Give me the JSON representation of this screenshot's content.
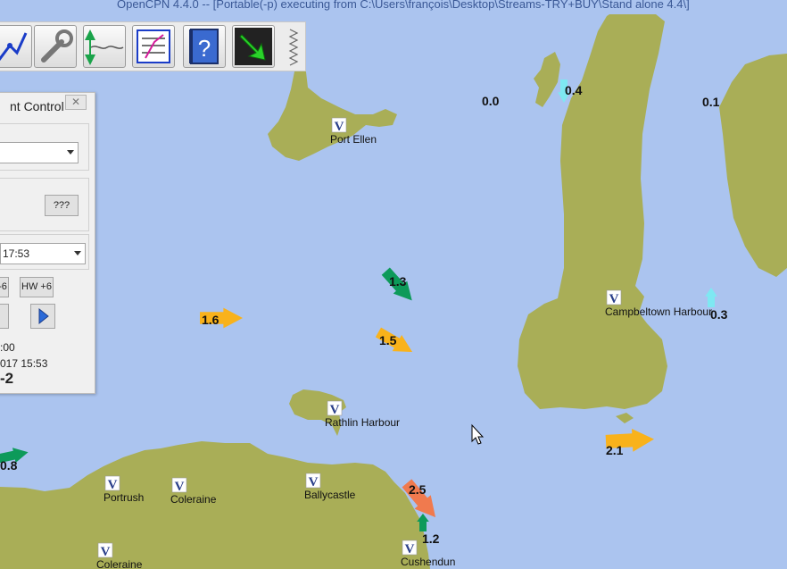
{
  "window": {
    "title": "OpenCPN 4.4.0 -- [Portable(-p) executing from C:\\Users\\françois\\Desktop\\Streams-TRY+BUY\\Stand alone 4.4\\]"
  },
  "toolbar": {
    "buttons": [
      {
        "name": "route-icon"
      },
      {
        "name": "settings-wrench-icon"
      },
      {
        "name": "tide-current-icon"
      },
      {
        "name": "route-manager-icon"
      },
      {
        "name": "help-icon"
      },
      {
        "name": "plugin-arrow-icon"
      }
    ]
  },
  "panel": {
    "title": "nt Control",
    "close": "✕",
    "query_button": "???",
    "time_select": "17:53",
    "hw_minus_button": "-6",
    "hw_plus_button": "HW +6",
    "line1": ":00",
    "line2": "017 15:53",
    "line3": "-2"
  },
  "places": [
    {
      "id": "port-ellen",
      "label": "Port Ellen"
    },
    {
      "id": "campbeltown",
      "label": "Campbeltown Harbour"
    },
    {
      "id": "rathlin",
      "label": "Rathlin Harbour"
    },
    {
      "id": "portrush",
      "label": "Portrush"
    },
    {
      "id": "coleraine1",
      "label": "Coleraine"
    },
    {
      "id": "ballycastle",
      "label": "Ballycastle"
    },
    {
      "id": "coleraine2",
      "label": "Coleraine"
    },
    {
      "id": "cushendun",
      "label": "Cushendun"
    }
  ],
  "currents": [
    {
      "label": "0.0"
    },
    {
      "label": "0.4"
    },
    {
      "label": "0.1"
    },
    {
      "label": "1.3"
    },
    {
      "label": "0.3"
    },
    {
      "label": "1.6"
    },
    {
      "label": "1.5"
    },
    {
      "label": "2.1"
    },
    {
      "label": "0.8"
    },
    {
      "label": "2.5"
    },
    {
      "label": "1.2"
    }
  ],
  "colors": {
    "sea": "#abc4ef",
    "land": "#a9ae57",
    "arrow_orange": "#f9b21b",
    "arrow_green": "#0d9a5a",
    "arrow_salmon": "#f07a4e",
    "arrow_cyan": "#7ee8f2"
  }
}
